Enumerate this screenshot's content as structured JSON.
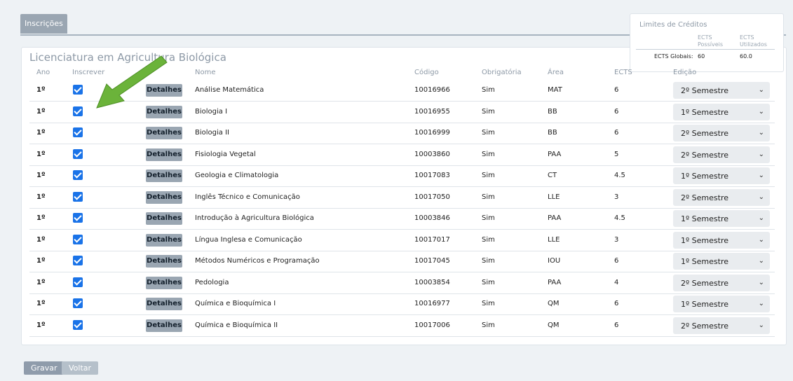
{
  "tabs": [
    {
      "label": "Inscrições",
      "active": true
    }
  ],
  "page_title": "Licenciatura em Agricultura Biológica",
  "credits": {
    "title": "Limites de Créditos",
    "col_possible": "ECTS\nPossíveis",
    "col_used": "ECTS\nUtilizados",
    "row_label": "ECTS Globais:",
    "possible": "60",
    "used": "60.0"
  },
  "table": {
    "headers": {
      "ano": "Ano",
      "inscrever": "Inscrever",
      "nome": "Nome",
      "codigo": "Código",
      "obrigatoria": "Obrigatória",
      "area": "Área",
      "ects": "ECTS",
      "edicao": "Edição"
    },
    "details_label": "Detalhes",
    "rows": [
      {
        "ano": "1º",
        "checked": true,
        "nome": "Análise Matemática",
        "codigo": "10016966",
        "obrigatoria": "Sim",
        "area": "MAT",
        "ects": "6",
        "edicao": "2º Semestre"
      },
      {
        "ano": "1º",
        "checked": true,
        "nome": "Biologia I",
        "codigo": "10016955",
        "obrigatoria": "Sim",
        "area": "BB",
        "ects": "6",
        "edicao": "1º Semestre"
      },
      {
        "ano": "1º",
        "checked": true,
        "nome": "Biologia II",
        "codigo": "10016999",
        "obrigatoria": "Sim",
        "area": "BB",
        "ects": "6",
        "edicao": "2º Semestre"
      },
      {
        "ano": "1º",
        "checked": true,
        "nome": "Fisiologia Vegetal",
        "codigo": "10003860",
        "obrigatoria": "Sim",
        "area": "PAA",
        "ects": "5",
        "edicao": "2º Semestre"
      },
      {
        "ano": "1º",
        "checked": true,
        "nome": "Geologia e Climatologia",
        "codigo": "10017083",
        "obrigatoria": "Sim",
        "area": "CT",
        "ects": "4.5",
        "edicao": "1º Semestre"
      },
      {
        "ano": "1º",
        "checked": true,
        "nome": "Inglês Técnico e Comunicação",
        "codigo": "10017050",
        "obrigatoria": "Sim",
        "area": "LLE",
        "ects": "3",
        "edicao": "2º Semestre"
      },
      {
        "ano": "1º",
        "checked": true,
        "nome": "Introdução à Agricultura Biológica",
        "codigo": "10003846",
        "obrigatoria": "Sim",
        "area": "PAA",
        "ects": "4.5",
        "edicao": "1º Semestre"
      },
      {
        "ano": "1º",
        "checked": true,
        "nome": "Língua Inglesa e Comunicação",
        "codigo": "10017017",
        "obrigatoria": "Sim",
        "area": "LLE",
        "ects": "3",
        "edicao": "1º Semestre"
      },
      {
        "ano": "1º",
        "checked": true,
        "nome": "Métodos Numéricos e Programação",
        "codigo": "10017045",
        "obrigatoria": "Sim",
        "area": "IOU",
        "ects": "6",
        "edicao": "1º Semestre"
      },
      {
        "ano": "1º",
        "checked": true,
        "nome": "Pedologia",
        "codigo": "10003854",
        "obrigatoria": "Sim",
        "area": "PAA",
        "ects": "4",
        "edicao": "2º Semestre"
      },
      {
        "ano": "1º",
        "checked": true,
        "nome": "Química e Bioquímica I",
        "codigo": "10016977",
        "obrigatoria": "Sim",
        "area": "QM",
        "ects": "6",
        "edicao": "1º Semestre"
      },
      {
        "ano": "1º",
        "checked": true,
        "nome": "Química e Bioquímica II",
        "codigo": "10017006",
        "obrigatoria": "Sim",
        "area": "QM",
        "ects": "6",
        "edicao": "2º Semestre"
      }
    ]
  },
  "buttons": {
    "save": "Gravar",
    "back": "Voltar"
  },
  "icons": {
    "checkbox": "checkbox-checked-icon",
    "chevron": "chevron-down-icon",
    "annotation": "green-arrow-annotation"
  },
  "colors": {
    "accent": "#1a73e8",
    "header_bg": "#9aa6b2",
    "arrow": "#6bb33a"
  }
}
